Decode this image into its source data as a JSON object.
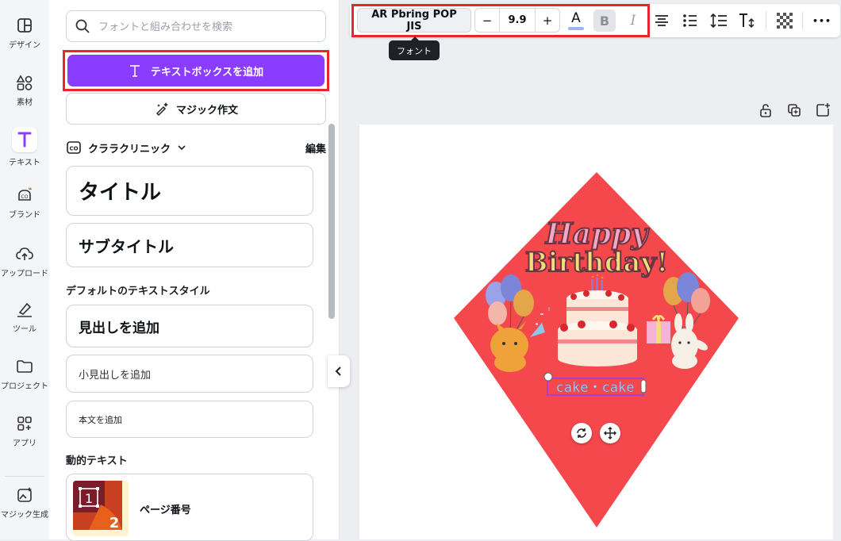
{
  "rail": {
    "items": [
      {
        "label": "デザイン",
        "icon": "layout-icon"
      },
      {
        "label": "素材",
        "icon": "elements-icon"
      },
      {
        "label": "テキスト",
        "icon": "text-icon"
      },
      {
        "label": "ブランド",
        "icon": "brand-icon"
      },
      {
        "label": "アップロード",
        "icon": "upload-cloud-icon"
      },
      {
        "label": "ツール",
        "icon": "draw-tool-icon"
      },
      {
        "label": "プロジェクト",
        "icon": "folder-icon"
      },
      {
        "label": "アプリ",
        "icon": "apps-icon"
      },
      {
        "label": "マジック生成",
        "icon": "magic-image-icon"
      }
    ],
    "active": "テキスト"
  },
  "panel": {
    "search_placeholder": "フォントと組み合わせを検索",
    "add_textbox": "テキストボックスを追加",
    "magic_write": "マジック作文",
    "brand_kit": {
      "name": "クララクリニック",
      "edit": "編集"
    },
    "brand_styles": [
      {
        "label": "タイトル"
      },
      {
        "label": "サブタイトル"
      }
    ],
    "default_styles_heading": "デフォルトのテキストスタイル",
    "default_styles": [
      {
        "label": "見出しを追加"
      },
      {
        "label": "小見出しを追加"
      },
      {
        "label": "本文を追加"
      }
    ],
    "dynamic_heading": "動的テキスト",
    "dynamic_items": [
      {
        "label": "ページ番号",
        "thumb_numbers": [
          "1",
          "2"
        ]
      }
    ]
  },
  "toolbar": {
    "font": "AR Pbring POP JIS",
    "size": "9.9",
    "minus": "−",
    "plus": "+",
    "text_color_letter": "A",
    "bold": "B",
    "italic": "I",
    "more": "•••",
    "tooltip": "フォント",
    "colors": {
      "text_color_swatch": "#9db4f2",
      "highlight": "#e7262d"
    }
  },
  "canvas": {
    "bg": "#ffffff",
    "shape_color": "#f4484d",
    "header_line1": "Happy",
    "header_line2": "Birthday!",
    "selected_text": "cake・cake"
  }
}
